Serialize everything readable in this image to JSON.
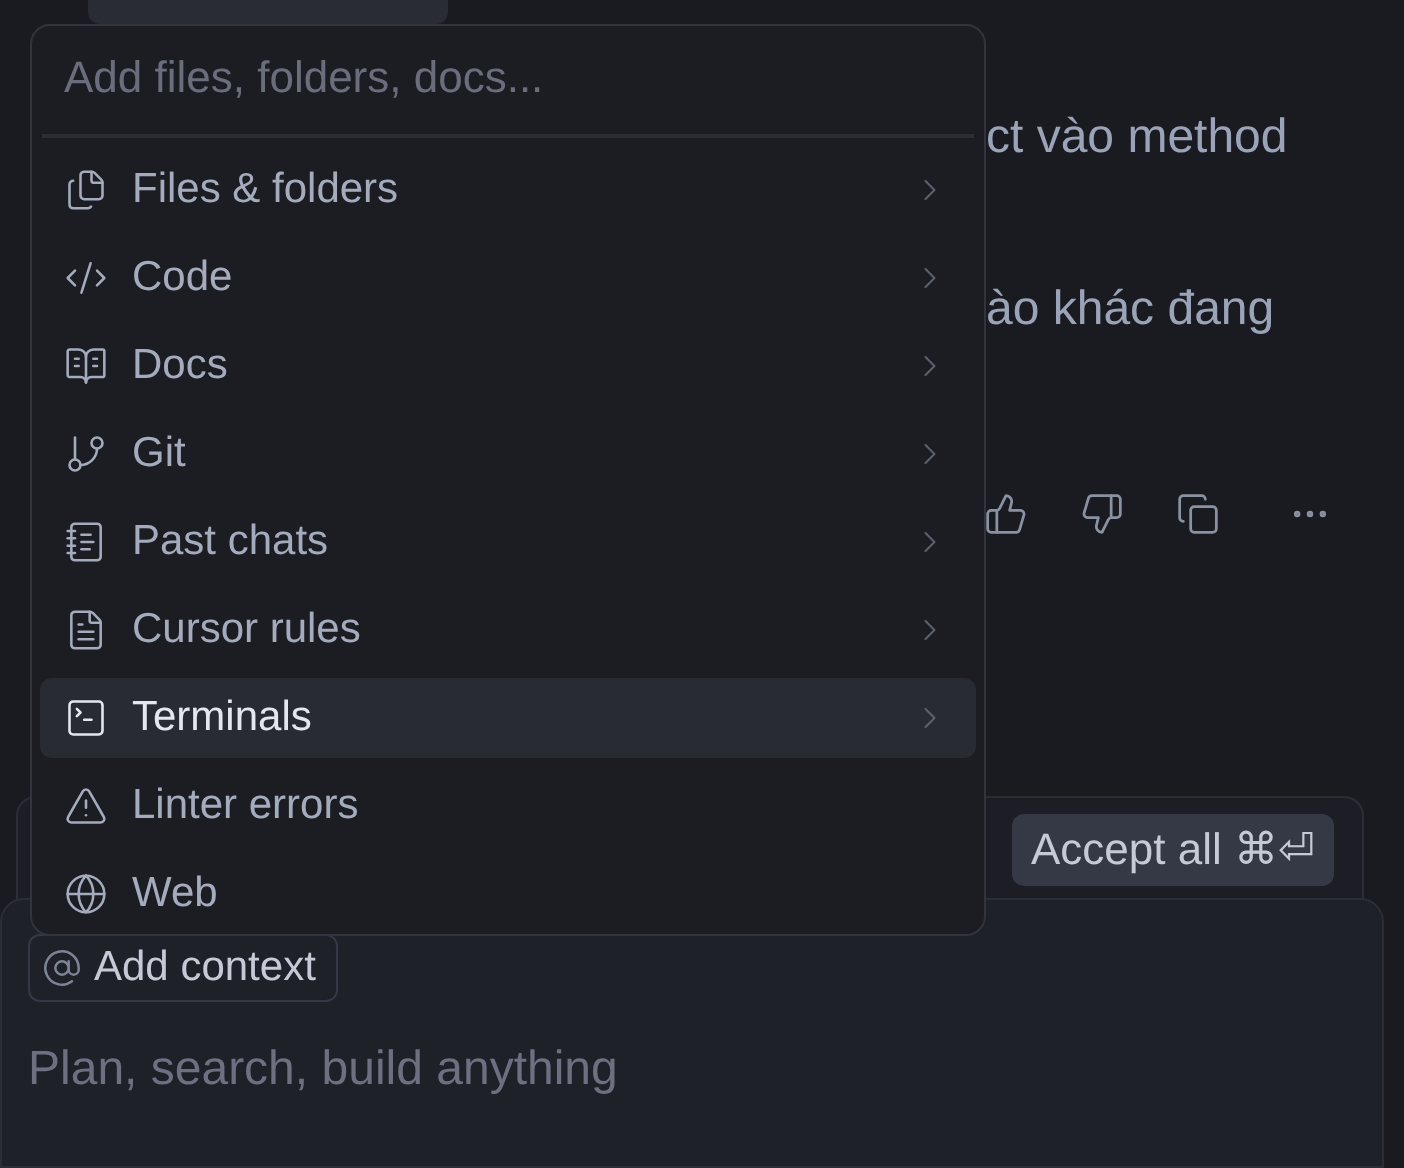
{
  "message": {
    "lines": [
      "ct vào method",
      "ào khác đang"
    ]
  },
  "popup": {
    "search": {
      "placeholder": "Add files, folders, docs..."
    },
    "items": [
      {
        "label": "Files & folders",
        "selected": false,
        "submenu": true
      },
      {
        "label": "Code",
        "selected": false,
        "submenu": true
      },
      {
        "label": "Docs",
        "selected": false,
        "submenu": true
      },
      {
        "label": "Git",
        "selected": false,
        "submenu": true
      },
      {
        "label": "Past chats",
        "selected": false,
        "submenu": true
      },
      {
        "label": "Cursor rules",
        "selected": false,
        "submenu": true
      },
      {
        "label": "Terminals",
        "selected": true,
        "submenu": true
      },
      {
        "label": "Linter errors",
        "selected": false,
        "submenu": false
      },
      {
        "label": "Web",
        "selected": false,
        "submenu": false
      }
    ]
  },
  "accept_button": {
    "label": "Accept all ⌘⏎"
  },
  "composer": {
    "context_chip": "Add context",
    "placeholder": "Plan, search, build anything"
  }
}
